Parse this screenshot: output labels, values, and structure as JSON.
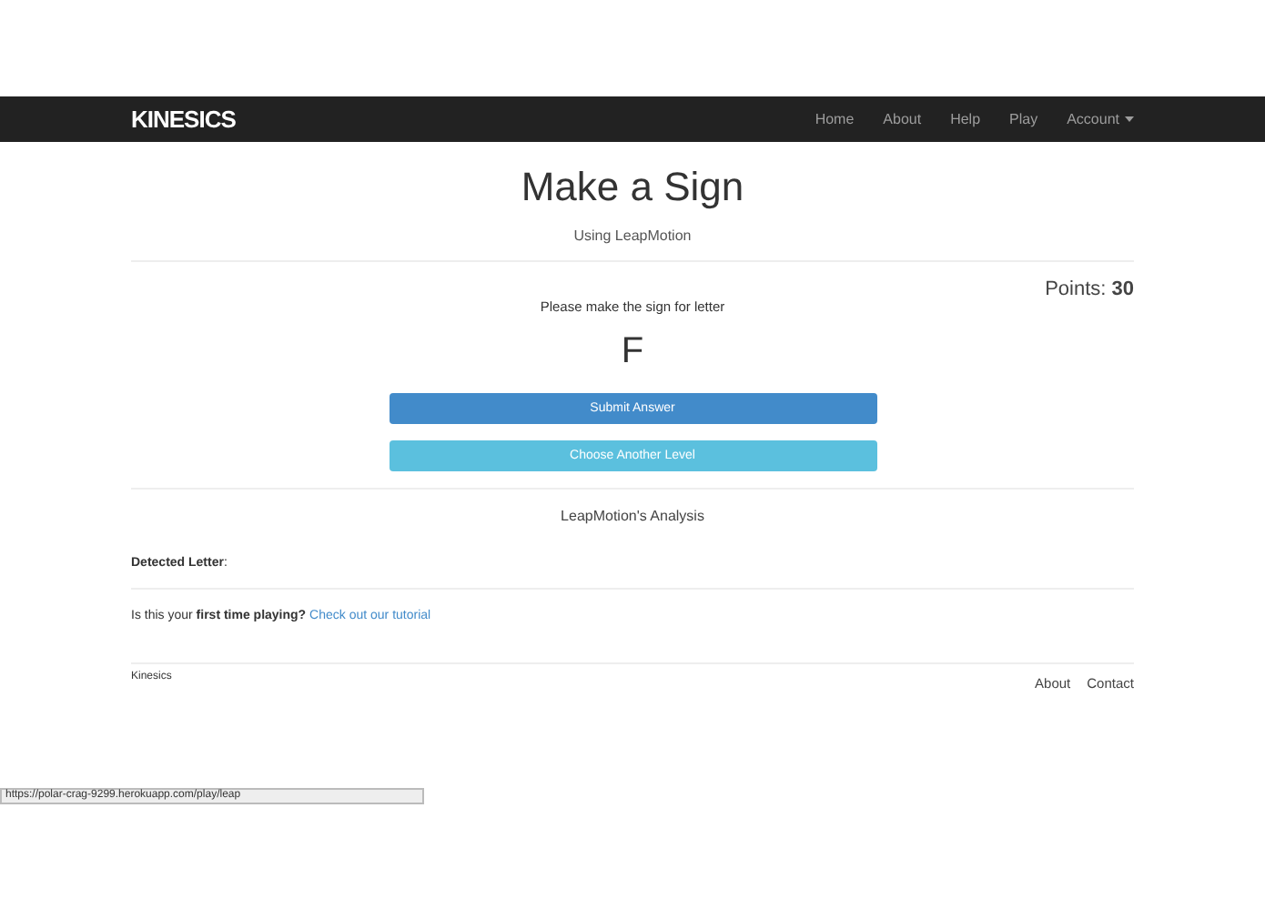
{
  "navbar": {
    "brand": "KINESICS",
    "links": [
      {
        "label": "Home",
        "kind": "link"
      },
      {
        "label": "About",
        "kind": "link"
      },
      {
        "label": "Help",
        "kind": "link"
      },
      {
        "label": "Play",
        "kind": "link"
      },
      {
        "label": "Account",
        "kind": "dropdown"
      }
    ]
  },
  "header": {
    "title": "Make a Sign",
    "subtitle": "Using LeapMotion"
  },
  "points": "Points: **30**",
  "prompt": "Please make the sign for letter",
  "letter": "F",
  "buttons": [
    {
      "label": "Submit Answer",
      "kind": "primary"
    },
    {
      "label": "Choose Another Level",
      "kind": "info"
    }
  ],
  "analysis": {
    "title": "LeapMotion's Analysis",
    "detected": "**Detected Letter**:"
  },
  "tutorial": {
    "text": "Is this your **first time playing?**",
    "link": "Check out our tutorial"
  },
  "footer": {
    "brand": "Kinesics",
    "links": [
      "About",
      "Contact"
    ]
  },
  "status_url": "https://polar-crag-9299.herokuapp.com/play/leap"
}
